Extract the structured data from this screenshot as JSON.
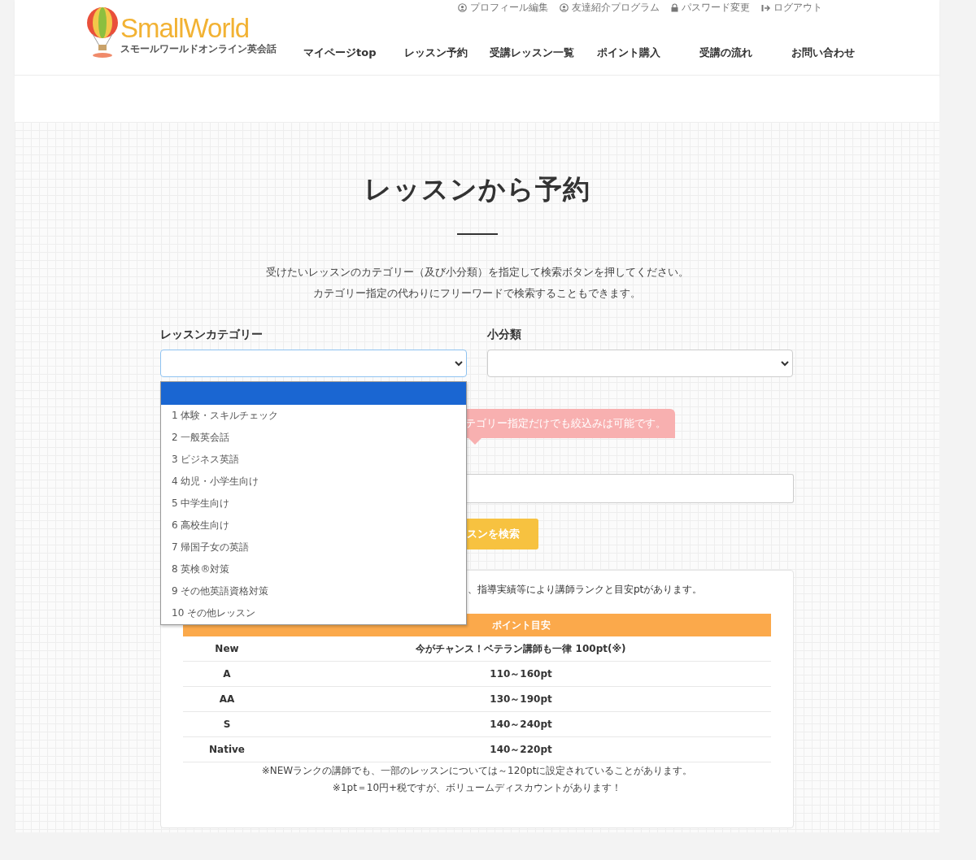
{
  "header": {
    "logo": {
      "name": "SmallWorld",
      "tagline": "スモールワールドオンライン英会話"
    },
    "account_links": [
      {
        "label": "プロフィール編集",
        "kind": "user"
      },
      {
        "label": "友達紹介プログラム",
        "kind": "user"
      },
      {
        "label": "パスワード変更",
        "kind": "lock"
      },
      {
        "label": "ログアウト",
        "kind": "logout"
      }
    ],
    "nav": [
      "マイページtop",
      "レッスン予約",
      "受講レッスン一覧",
      "ポイント購入",
      "受講の流れ",
      "お問い合わせ"
    ]
  },
  "page": {
    "title": "レッスンから予約",
    "description": [
      "受けたいレッスンのカテゴリー（及び小分類）を指定して検索ボタンを押してください。",
      "カテゴリー指定の代わりにフリーワードで検索することもできます。"
    ]
  },
  "form": {
    "category_label": "レッスンカテゴリー",
    "subcategory_label": "小分類",
    "category_open": true,
    "category_options": [
      {
        "selected": true
      },
      {
        "label": "1 体験・スキルチェック",
        "selected": false
      },
      {
        "label": "2 一般英会話",
        "selected": false
      },
      {
        "label": "3 ビジネス英語",
        "selected": false
      },
      {
        "label": "4 幼児・小学生向け",
        "selected": false
      },
      {
        "label": "5 中学生向け",
        "selected": false
      },
      {
        "label": "6 高校生向け",
        "selected": false
      },
      {
        "label": "7 帰国子女の英語",
        "selected": false
      },
      {
        "label": "8 英検®対策",
        "selected": false
      },
      {
        "label": "9 その他英語資格対策",
        "selected": false
      },
      {
        "label": "10 その他レッスン",
        "selected": false
      }
    ],
    "tooltip": "テゴリー指定だけでも絞込みは可能です。",
    "search_button": "スンを検索"
  },
  "rank_info": {
    "intro": "、指導実績等により講師ランクと目安ptがあります。",
    "table": {
      "columns": [
        "",
        "ポイント目安"
      ],
      "rows": [
        [
          "New",
          "今がチャンス！ベテラン講師も一律 100pt(※)"
        ],
        [
          "A",
          "110～160pt"
        ],
        [
          "AA",
          "130～190pt"
        ],
        [
          "S",
          "140～240pt"
        ],
        [
          "Native",
          "140～220pt"
        ]
      ]
    },
    "notes": [
      "※NEWランクの講師でも、一部のレッスンについては～120ptに設定されていることがあります。",
      "※1pt＝10円+税ですが、ボリュームディスカウントがあります！"
    ]
  }
}
